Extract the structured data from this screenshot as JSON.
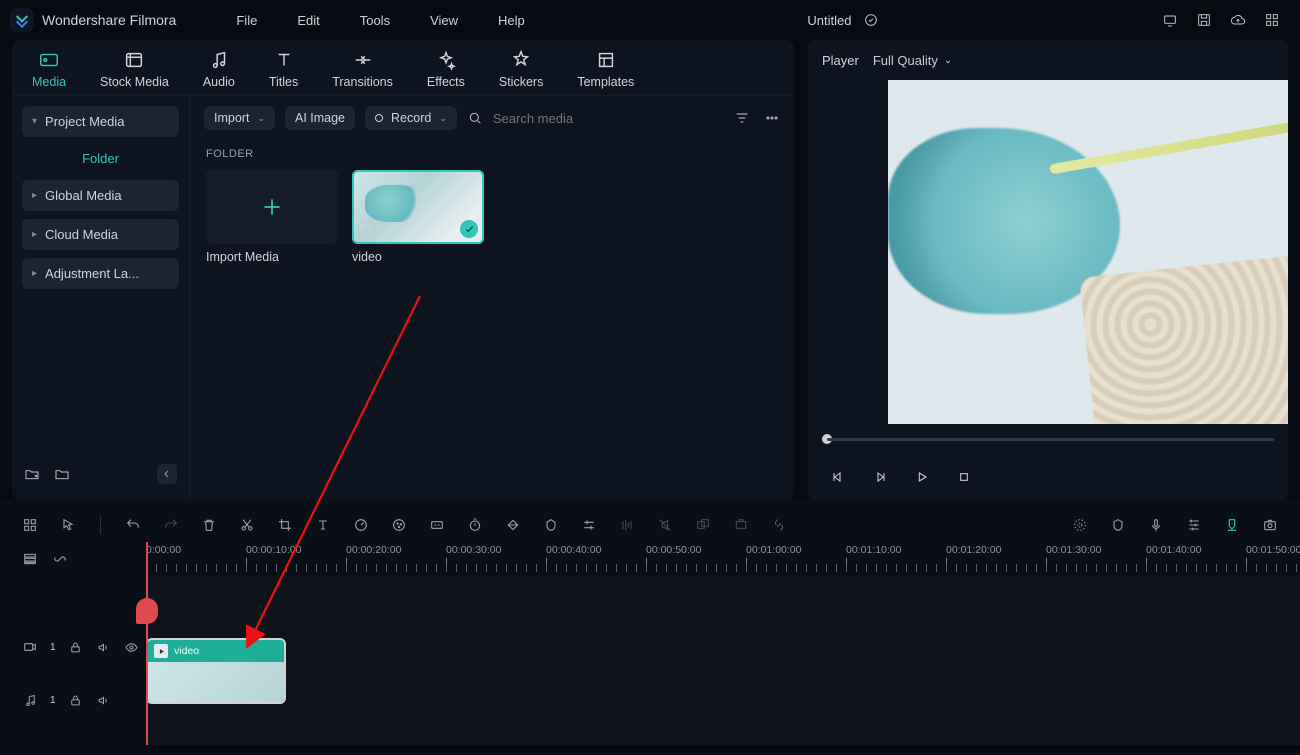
{
  "app": {
    "brand": "Wondershare Filmora",
    "document_title": "Untitled"
  },
  "menu": {
    "file": "File",
    "edit": "Edit",
    "tools": "Tools",
    "view": "View",
    "help": "Help"
  },
  "tabs": {
    "media": "Media",
    "stock": "Stock Media",
    "audio": "Audio",
    "titles": "Titles",
    "transitions": "Transitions",
    "effects": "Effects",
    "stickers": "Stickers",
    "templates": "Templates"
  },
  "sidebar": {
    "project_media": "Project Media",
    "folder_label": "Folder",
    "items": [
      "Global Media",
      "Cloud Media",
      "Adjustment La..."
    ]
  },
  "toolbar": {
    "import": "Import",
    "ai_image": "AI Image",
    "record": "Record",
    "search_placeholder": "Search media"
  },
  "folder": {
    "heading": "FOLDER",
    "import_media": "Import Media",
    "video_label": "video"
  },
  "player": {
    "label": "Player",
    "quality": "Full Quality"
  },
  "timeline": {
    "labels": [
      "0:00:00",
      "00:00:10:00",
      "00:00:20:00",
      "00:00:30:00",
      "00:00:40:00",
      "00:00:50:00",
      "00:01:00:00",
      "00:01:10:00",
      "00:01:20:00",
      "00:01:30:00",
      "00:01:40:00",
      "00:01:50:00"
    ],
    "video_track_index": "1",
    "audio_track_index": "1",
    "clip_label": "video"
  }
}
